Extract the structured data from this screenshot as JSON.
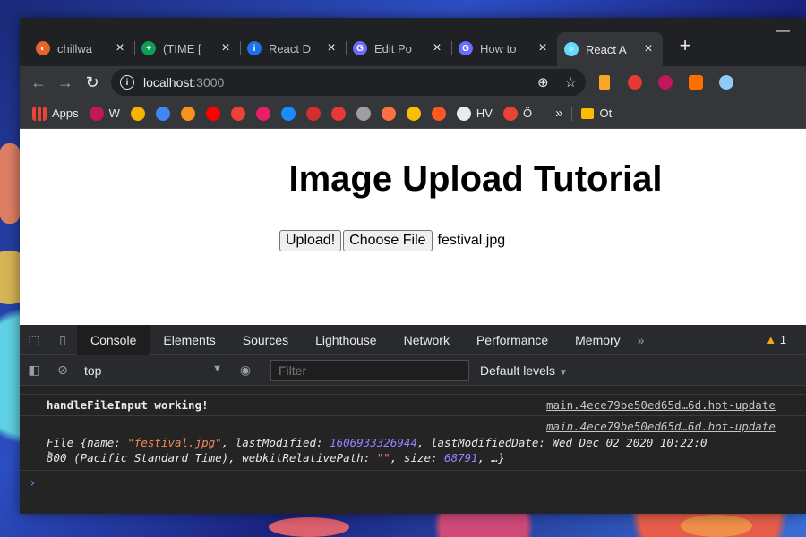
{
  "browser": {
    "tabs": [
      {
        "title": "chillwa",
        "color": "#e8632d",
        "glyph": "◐"
      },
      {
        "title": "(TIME [",
        "color": "#0f9d58",
        "glyph": "+"
      },
      {
        "title": "React D",
        "color": "#1a73e8",
        "glyph": "i"
      },
      {
        "title": "Edit Po",
        "color": "#6c6cff",
        "glyph": "G"
      },
      {
        "title": "How to",
        "color": "#6c6cff",
        "glyph": "G"
      },
      {
        "title": "React A",
        "color": "#61dafb",
        "glyph": "⚛",
        "active": true
      }
    ],
    "new_tab": "+",
    "address": {
      "host": "localhost",
      "port": ":3000"
    },
    "bookmarks": [
      {
        "label": "Apps",
        "color": "#ea4335"
      },
      {
        "label": "W",
        "color": "#c2185b"
      },
      {
        "label": "",
        "color": "#f4b400"
      },
      {
        "label": "",
        "color": "#4285f4"
      },
      {
        "label": "",
        "color": "#f7931a"
      },
      {
        "label": "",
        "color": "#ff0000"
      },
      {
        "label": "",
        "color": "#ea4335"
      },
      {
        "label": "",
        "color": "#e91e63"
      },
      {
        "label": "",
        "color": "#1a8cff"
      },
      {
        "label": "",
        "color": "#d32f2f"
      },
      {
        "label": "",
        "color": "#e53935"
      },
      {
        "label": "",
        "color": "#9e9e9e"
      },
      {
        "label": "",
        "color": "#ff7043"
      },
      {
        "label": "",
        "color": "#fbbc04"
      },
      {
        "label": "",
        "color": "#ff5722"
      },
      {
        "label": "HV",
        "color": "#e8eaed"
      },
      {
        "label": "Ö",
        "color": "#ea4335"
      }
    ],
    "bookmarks_more": "»",
    "other_bookmarks": "Ot"
  },
  "page": {
    "heading": "Image Upload Tutorial",
    "upload_button": "Upload!",
    "choose_button": "Choose File",
    "file_name": "festival.jpg"
  },
  "devtools": {
    "tabs": [
      "Console",
      "Elements",
      "Sources",
      "Lighthouse",
      "Network",
      "Performance",
      "Memory"
    ],
    "more": "»",
    "warnings": "1",
    "context": "top",
    "filter_placeholder": "Filter",
    "levels": "Default levels",
    "log1": {
      "text": "handleFileInput working!",
      "source": "main.4ece79be50ed65d…6d.hot-update"
    },
    "log2": {
      "source": "main.4ece79be50ed65d…6d.hot-update",
      "prefix": "File {name: ",
      "name": "\"festival.jpg\"",
      "lm_label": ", lastModified: ",
      "lm": "1606933326944",
      "lmd_label": ", lastModifiedDate: Wed Dec 02 2020 10:22:0",
      "line2_a": "800 (Pacific Standard Time), webkitRelativePath: ",
      "wrp": "\"\"",
      "size_label": ", size: ",
      "size": "68791",
      "suffix": ", …}"
    },
    "prompt": "›"
  }
}
